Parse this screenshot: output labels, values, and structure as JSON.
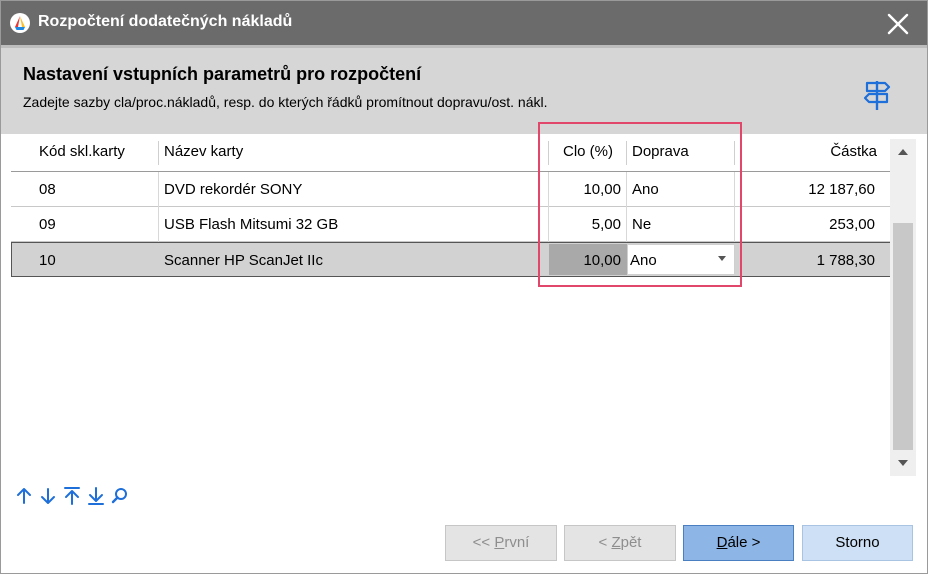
{
  "window": {
    "title": "Rozpočtení dodatečných nákladů"
  },
  "header": {
    "title": "Nastavení vstupních parametrů pro rozpočtení",
    "subtitle": "Zadejte sazby cla/proc.nákladů, resp. do kterých řádků promítnout dopravu/ost. nákl."
  },
  "grid": {
    "columns": {
      "code": "Kód skl.karty",
      "name": "Název karty",
      "clo": "Clo (%)",
      "doprava": "Doprava",
      "castka": "Částka"
    },
    "rows": [
      {
        "code": "08",
        "name": "DVD rekordér SONY",
        "clo": "10,00",
        "doprava": "Ano",
        "castka": "12 187,60"
      },
      {
        "code": "09",
        "name": "USB Flash Mitsumi 32 GB",
        "clo": "5,00",
        "doprava": "Ne",
        "castka": "253,00"
      },
      {
        "code": "10",
        "name": "Scanner HP ScanJet IIc",
        "clo": "10,00",
        "doprava": "Ano",
        "castka": "1 788,30"
      }
    ],
    "selected_row": 2
  },
  "buttons": {
    "first": {
      "prefix": "<< ",
      "accel": "P",
      "rest": "rvní"
    },
    "back": {
      "prefix": "< ",
      "accel": "Z",
      "rest": "pět"
    },
    "next": {
      "prefix": "",
      "accel": "D",
      "rest": "ále >"
    },
    "cancel": {
      "label": "Storno"
    }
  },
  "icons": {
    "app": "app-logo-icon",
    "close": "close-icon",
    "help": "signpost-icon",
    "nav": [
      "arrow-up-icon",
      "arrow-down-icon",
      "arrow-top-icon",
      "arrow-bottom-icon",
      "search-icon"
    ]
  },
  "colors": {
    "accent": "#1e6fd9",
    "highlight": "#e0476a",
    "primary_button": "#8db6e6"
  }
}
